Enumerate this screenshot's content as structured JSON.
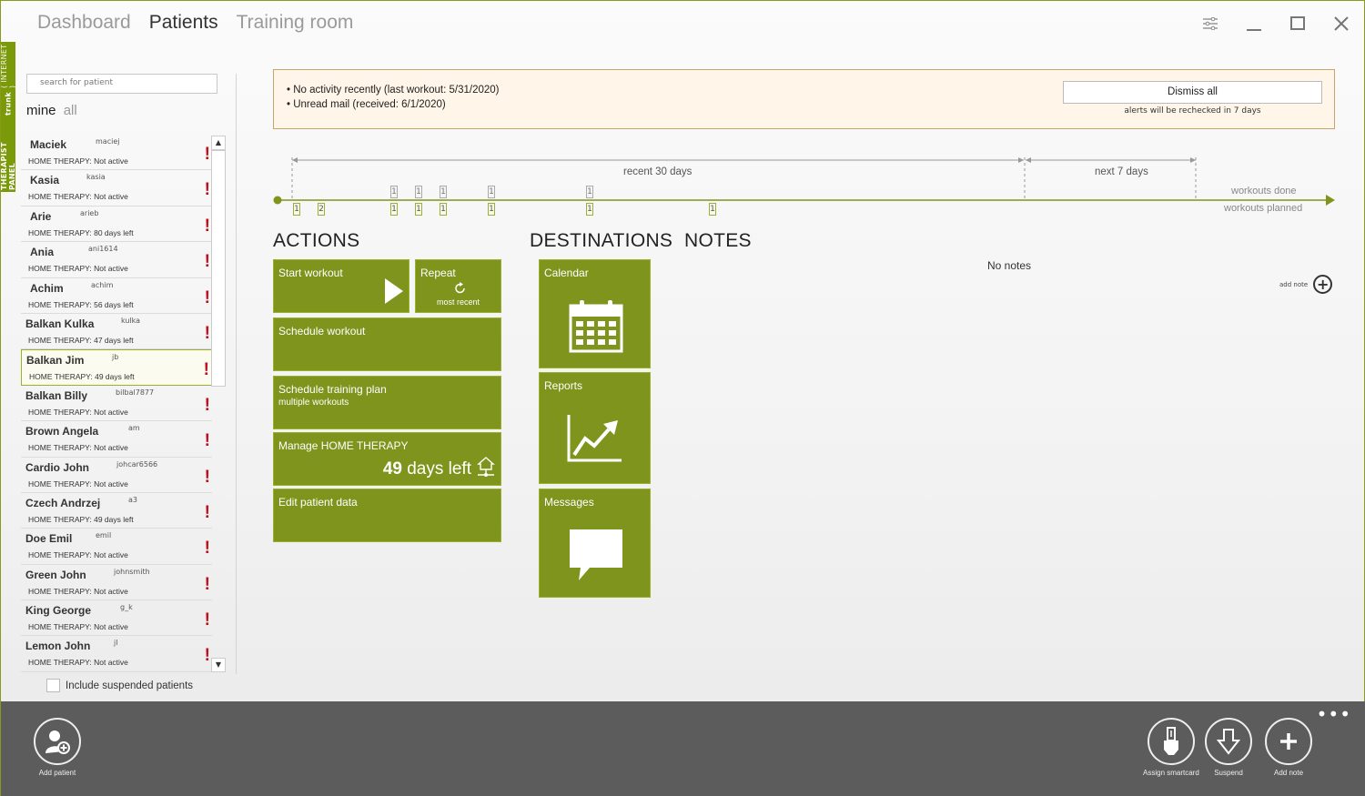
{
  "window": {
    "side_ribbon": {
      "title": "THERAPIST PANEL",
      "branch": "trunk",
      "mode": "( INTERNET )"
    },
    "tabs": [
      {
        "label": "Dashboard",
        "active": false
      },
      {
        "label": "Patients",
        "active": true
      },
      {
        "label": "Training room",
        "active": false
      }
    ],
    "controls": [
      "settings-icon",
      "minimize-icon",
      "maximize-icon",
      "close-icon"
    ]
  },
  "sidebar": {
    "search_placeholder": "search for patient",
    "filter_mine": "mine",
    "filter_all": "all",
    "patients": [
      {
        "name": "Maciek",
        "login": "maciej",
        "status": "HOME THERAPY: Not active",
        "alert": "!"
      },
      {
        "name": "Kasia",
        "login": "kasia",
        "status": "HOME THERAPY: Not active",
        "alert": "!"
      },
      {
        "name": "Arie",
        "login": "arieb",
        "status": "HOME THERAPY:  80 days left",
        "alert": "!"
      },
      {
        "name": "Ania",
        "login": "ani1614",
        "status": "HOME THERAPY: Not active",
        "alert": "!"
      },
      {
        "name": "Achim",
        "login": "achim",
        "status": "HOME THERAPY:  56 days left",
        "alert": "!"
      },
      {
        "name": "Balkan Kulka",
        "login": "kulka",
        "status": "HOME THERAPY:  47 days left",
        "alert": "!"
      },
      {
        "name": "Balkan Jim",
        "login": "jb",
        "status": "HOME THERAPY:  49 days left",
        "alert": "!",
        "selected": true
      },
      {
        "name": "Balkan Billy",
        "login": "bilbal7877",
        "status": "HOME THERAPY: Not active",
        "alert": "!"
      },
      {
        "name": "Brown Angela",
        "login": "am",
        "status": "HOME THERAPY: Not active",
        "alert": "!"
      },
      {
        "name": "Cardio John",
        "login": "johcar6566",
        "status": "HOME THERAPY: Not active",
        "alert": "!"
      },
      {
        "name": "Czech Andrzej",
        "login": "a3",
        "status": "HOME THERAPY:  49 days left",
        "alert": "!"
      },
      {
        "name": "Doe Emil",
        "login": "emil",
        "status": "HOME THERAPY: Not active",
        "alert": "!"
      },
      {
        "name": "Green John",
        "login": "johnsmith",
        "status": "HOME THERAPY: Not active",
        "alert": "!"
      },
      {
        "name": "King George",
        "login": "g_k",
        "status": "HOME THERAPY: Not active",
        "alert": "!"
      },
      {
        "name": "Lemon John",
        "login": "jl",
        "status": "HOME THERAPY: Not active",
        "alert": "!"
      }
    ],
    "include_suspended_label": "Include suspended patients"
  },
  "alerts": {
    "lines": [
      "• No activity recently (last workout: 5/31/2020)",
      "• Unread mail (received: 6/1/2020)"
    ],
    "dismiss_label": "Dismiss all",
    "recheck_note": "alerts will be rechecked in 7 days"
  },
  "timeline": {
    "recent_label": "recent 30 days",
    "next_label": "next 7 days",
    "legend_done": "workouts done",
    "legend_planned": "workouts planned",
    "done_markers": [
      "1",
      "1",
      "1",
      "1",
      "1"
    ],
    "planned_markers": [
      "1",
      "2",
      "1",
      "1",
      "1",
      "1",
      "1",
      "1"
    ]
  },
  "sections": {
    "actions": "ACTIONS",
    "destinations": "DESTINATIONS",
    "notes": "NOTES"
  },
  "actions": {
    "start_workout": "Start workout",
    "repeat": "Repeat",
    "repeat_sub": "most recent",
    "schedule_workout": "Schedule workout",
    "schedule_plan": "Schedule training plan",
    "schedule_plan_sub": "multiple workouts",
    "manage_home": "Manage  HOME THERAPY",
    "days_left_num": "49",
    "days_left_text": "days left",
    "edit_patient": "Edit patient data"
  },
  "destinations": {
    "calendar": "Calendar",
    "reports": "Reports",
    "messages": "Messages"
  },
  "notes": {
    "empty_text": "No notes",
    "add_note_label": "add note"
  },
  "bottom_bar": {
    "add_patient": "Add patient",
    "assign_smartcard": "Assign smartcard",
    "suspend": "Suspend",
    "add_note": "Add note",
    "more": "•••"
  },
  "colors": {
    "accent": "#7f941c",
    "alert_red": "#c0101e",
    "alert_bg": "#fff5e8",
    "bottom_bar": "#5c5c5c"
  }
}
